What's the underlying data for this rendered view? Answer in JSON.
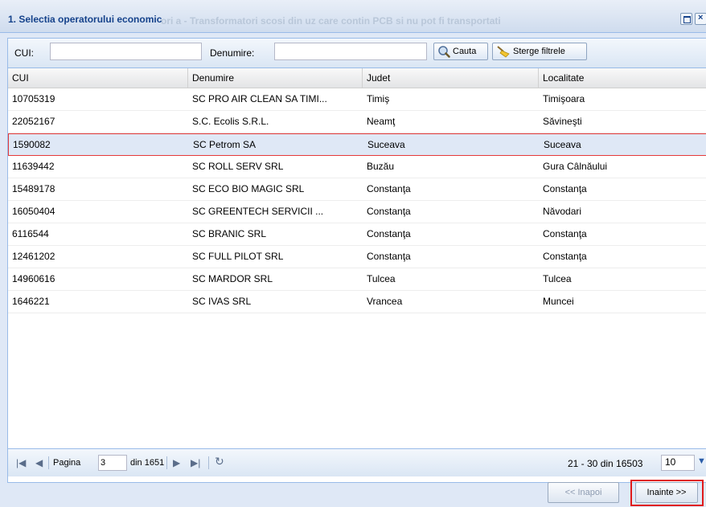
{
  "window": {
    "title": "1. Selectia operatorului economic",
    "background_title": "ori a - Transformatori scosi din uz care contin PCB si nu pot fi transportati"
  },
  "filters": {
    "cui_label": "CUI:",
    "cui_value": "",
    "denumire_label": "Denumire:",
    "denumire_value": "",
    "search_label": "Cauta",
    "clear_label": "Sterge filtrele"
  },
  "grid": {
    "columns": [
      "CUI",
      "Denumire",
      "Judet",
      "Localitate"
    ],
    "rows": [
      {
        "cui": "10705319",
        "denumire": "SC PRO AIR CLEAN SA TIMI...",
        "judet": "Timiş",
        "localitate": "Timişoara"
      },
      {
        "cui": "22052167",
        "denumire": "S.C. Ecolis S.R.L.",
        "judet": "Neamţ",
        "localitate": "Săvineşti"
      },
      {
        "cui": "1590082",
        "denumire": "SC Petrom SA",
        "judet": "Suceava",
        "localitate": "Suceava"
      },
      {
        "cui": "11639442",
        "denumire": "SC ROLL SERV SRL",
        "judet": "Buzău",
        "localitate": "Gura Câlnăului"
      },
      {
        "cui": "15489178",
        "denumire": "SC ECO BIO MAGIC SRL",
        "judet": "Constanţa",
        "localitate": "Constanţa"
      },
      {
        "cui": "16050404",
        "denumire": "SC GREENTECH SERVICII ...",
        "judet": "Constanţa",
        "localitate": "Năvodari"
      },
      {
        "cui": "6116544",
        "denumire": "SC BRANIC SRL",
        "judet": "Constanţa",
        "localitate": "Constanţa"
      },
      {
        "cui": "12461202",
        "denumire": "SC FULL PILOT SRL",
        "judet": "Constanţa",
        "localitate": "Constanţa"
      },
      {
        "cui": "14960616",
        "denumire": "SC MARDOR SRL",
        "judet": "Tulcea",
        "localitate": "Tulcea"
      },
      {
        "cui": "1646221",
        "denumire": "SC IVAS SRL",
        "judet": "Vrancea",
        "localitate": "Muncei"
      }
    ],
    "selected_index": 2
  },
  "paging": {
    "page_label": "Pagina",
    "page_value": "3",
    "of_label": "din 1651",
    "range_text": "21 - 30 din 16503",
    "page_size": "10"
  },
  "footer": {
    "prev_label": "<< Inapoi",
    "next_label": "Inainte >>"
  },
  "colors": {
    "selected_row": "#dfe8f6",
    "highlight": "#e01b1b",
    "title": "#15428b"
  }
}
